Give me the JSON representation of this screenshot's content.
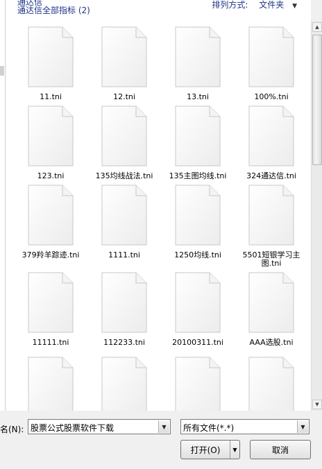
{
  "header": {
    "folder_title_top": "通达信",
    "folder_title": "通达信全部指标 (2)",
    "arrange_label": "排列方式:",
    "arrange_value": "文件夹"
  },
  "files": [
    {
      "name": "11.tni"
    },
    {
      "name": "12.tni"
    },
    {
      "name": "13.tni"
    },
    {
      "name": "100%.tni"
    },
    {
      "name": "123.tni"
    },
    {
      "name": "135均线战法.tni"
    },
    {
      "name": "135主图均线.tni"
    },
    {
      "name": "324通达信.tni"
    },
    {
      "name": "379羚羊踪迹.tni"
    },
    {
      "name": "1111.tni"
    },
    {
      "name": "1250均线.tni"
    },
    {
      "name": "5501短银学习主图.tni"
    },
    {
      "name": "11111.tni"
    },
    {
      "name": "112233.tni"
    },
    {
      "name": "20100311.tni"
    },
    {
      "name": "AAA选股.tni"
    },
    {
      "name": ""
    },
    {
      "name": ""
    },
    {
      "name": ""
    },
    {
      "name": ""
    }
  ],
  "bottom": {
    "filename_label": "名(N):",
    "filename_value": "股票公式股票软件下载",
    "filter_value": "所有文件(*.*)",
    "open_label": "打开(O)",
    "cancel_label": "取消"
  },
  "icons": {
    "file": "blank-document-icon",
    "dropdown": "chevron-down-icon",
    "scroll_up": "scroll-up-arrow-icon",
    "scroll_down": "scroll-down-arrow-icon"
  }
}
